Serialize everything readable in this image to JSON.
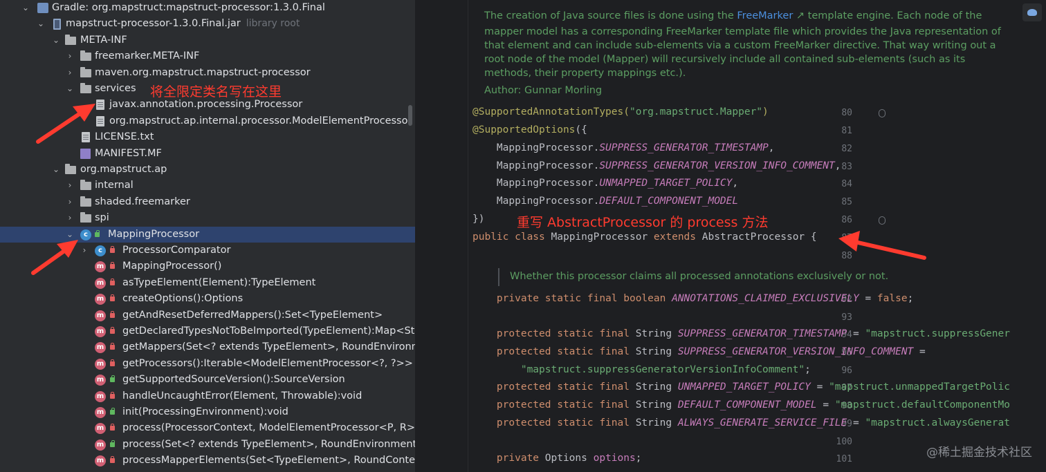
{
  "tree": {
    "rows": [
      {
        "label": "Gradle: org.mapstruct:mapstruct-processor:1.3.0.Final",
        "icon": "gradle-icon"
      },
      {
        "label": "mapstruct-processor-1.3.0.Final.jar",
        "extra": "library root",
        "icon": "jar-icon"
      },
      {
        "label": "META-INF",
        "icon": "folder-icon"
      },
      {
        "label": "freemarker.META-INF",
        "icon": "folder-icon"
      },
      {
        "label": "maven.org.mapstruct.mapstruct-processor",
        "icon": "folder-icon"
      },
      {
        "label": "services",
        "icon": "folder-icon"
      },
      {
        "label": "javax.annotation.processing.Processor",
        "icon": "file-icon"
      },
      {
        "label": "org.mapstruct.ap.internal.processor.ModelElementProcessor",
        "icon": "file-icon"
      },
      {
        "label": "LICENSE.txt",
        "icon": "file-icon"
      },
      {
        "label": "MANIFEST.MF",
        "icon": "manifest-icon"
      },
      {
        "label": "org.mapstruct.ap",
        "icon": "folder-icon"
      },
      {
        "label": "internal",
        "icon": "folder-icon"
      },
      {
        "label": "shaded.freemarker",
        "icon": "folder-icon"
      },
      {
        "label": "spi",
        "icon": "folder-icon"
      },
      {
        "label": "MappingProcessor",
        "icon": "class-icon"
      },
      {
        "label": "ProcessorComparator",
        "icon": "class-icon"
      },
      {
        "label": "MappingProcessor()",
        "icon": "method-icon"
      },
      {
        "label": "asTypeElement(Element):TypeElement",
        "icon": "method-icon"
      },
      {
        "label": "createOptions():Options",
        "icon": "method-icon"
      },
      {
        "label": "getAndResetDeferredMappers():Set<TypeElement>",
        "icon": "method-icon"
      },
      {
        "label": "getDeclaredTypesNotToBeImported(TypeElement):Map<St",
        "icon": "method-icon"
      },
      {
        "label": "getMappers(Set<? extends TypeElement>, RoundEnvironm",
        "icon": "method-icon"
      },
      {
        "label": "getProcessors():Iterable<ModelElementProcessor<?, ?>>",
        "icon": "method-icon"
      },
      {
        "label": "getSupportedSourceVersion():SourceVersion",
        "icon": "method-icon"
      },
      {
        "label": "handleUncaughtError(Element, Throwable):void",
        "icon": "method-icon"
      },
      {
        "label": "init(ProcessingEnvironment):void",
        "icon": "method-icon"
      },
      {
        "label": "process(ProcessorContext, ModelElementProcessor<P, R>",
        "icon": "method-icon"
      },
      {
        "label": "process(Set<? extends TypeElement>, RoundEnvironment)",
        "icon": "method-icon"
      },
      {
        "label": "processMapperElements(Set<TypeElement>, RoundConte:",
        "icon": "method-icon"
      }
    ]
  },
  "annotations": {
    "services_note": "将全限定类名写在这里",
    "process_note": "重写 AbstractProcessor 的 process 方法"
  },
  "editor": {
    "doc_lines": [
      "The creation of Java source files is done using the ",
      "FreeMarker",
      " template engine. Each node of the",
      "mapper model has a corresponding FreeMarker template file which provides the Java representation of",
      "that element and can include sub-elements via a custom FreeMarker directive. That way writing out a",
      "root node of the model (Mapper) will recursively include all contained sub-elements (such as its",
      "methods, their property mappings etc.).",
      "Author: Gunnar Morling"
    ],
    "doc2": "Whether this processor claims all processed annotations exclusively or not.",
    "line_numbers": [
      "80",
      "81",
      "82",
      "83",
      "84",
      "85",
      "86",
      "87",
      "88",
      "92",
      "93",
      "94",
      "95",
      "96",
      "97",
      "98",
      "99",
      "100",
      "101"
    ],
    "code": {
      "l80a": "@SupportedAnnotationTypes(",
      "l80b": "\"org.mapstruct.Mapper\"",
      "l80c": ")",
      "l81a": "@SupportedOptions",
      "l81b": "({",
      "l82a": "    MappingProcessor.",
      "l82b": "SUPPRESS_GENERATOR_TIMESTAMP",
      "l82c": ",",
      "l83a": "    MappingProcessor.",
      "l83b": "SUPPRESS_GENERATOR_VERSION_INFO_COMMENT",
      "l83c": ",",
      "l84a": "    MappingProcessor.",
      "l84b": "UNMAPPED_TARGET_POLICY",
      "l84c": ",",
      "l85a": "    MappingProcessor.",
      "l85b": "DEFAULT_COMPONENT_MODEL",
      "l86": "})",
      "l87a": "public class ",
      "l87b": "MappingProcessor ",
      "l87c": "extends ",
      "l87d": "AbstractProcessor {",
      "l92a": "    private static final boolean ",
      "l92b": "ANNOTATIONS_CLAIMED_EXCLUSIVELY",
      "l92c": " = ",
      "l92d": "false",
      "l92e": ";",
      "l94a": "    protected static final ",
      "l94b": "String ",
      "l94c": "SUPPRESS_GENERATOR_TIMESTAMP",
      "l94d": " = ",
      "l94e": "\"mapstruct.suppressGener",
      "l95a": "    protected static final ",
      "l95b": "String ",
      "l95c": "SUPPRESS_GENERATOR_VERSION_INFO_COMMENT",
      "l95d": " =",
      "l96": "        \"mapstruct.suppressGeneratorVersionInfoComment\"",
      "l96b": ";",
      "l97a": "    protected static final ",
      "l97b": "String ",
      "l97c": "UNMAPPED_TARGET_POLICY",
      "l97d": " = ",
      "l97e": "\"mapstruct.unmappedTargetPolic",
      "l98a": "    protected static final ",
      "l98b": "String ",
      "l98c": "DEFAULT_COMPONENT_MODEL",
      "l98d": " = ",
      "l98e": "\"mapstruct.defaultComponentMo",
      "l99a": "    protected static final ",
      "l99b": "String ",
      "l99c": "ALWAYS_GENERATE_SERVICE_FILE",
      "l99d": " = ",
      "l99e": "\"mapstruct.alwaysGenerat",
      "l101a": "    private ",
      "l101b": "Options ",
      "l101c": "options",
      "l101d": ";"
    }
  },
  "watermark": "@稀土掘金技术社区"
}
